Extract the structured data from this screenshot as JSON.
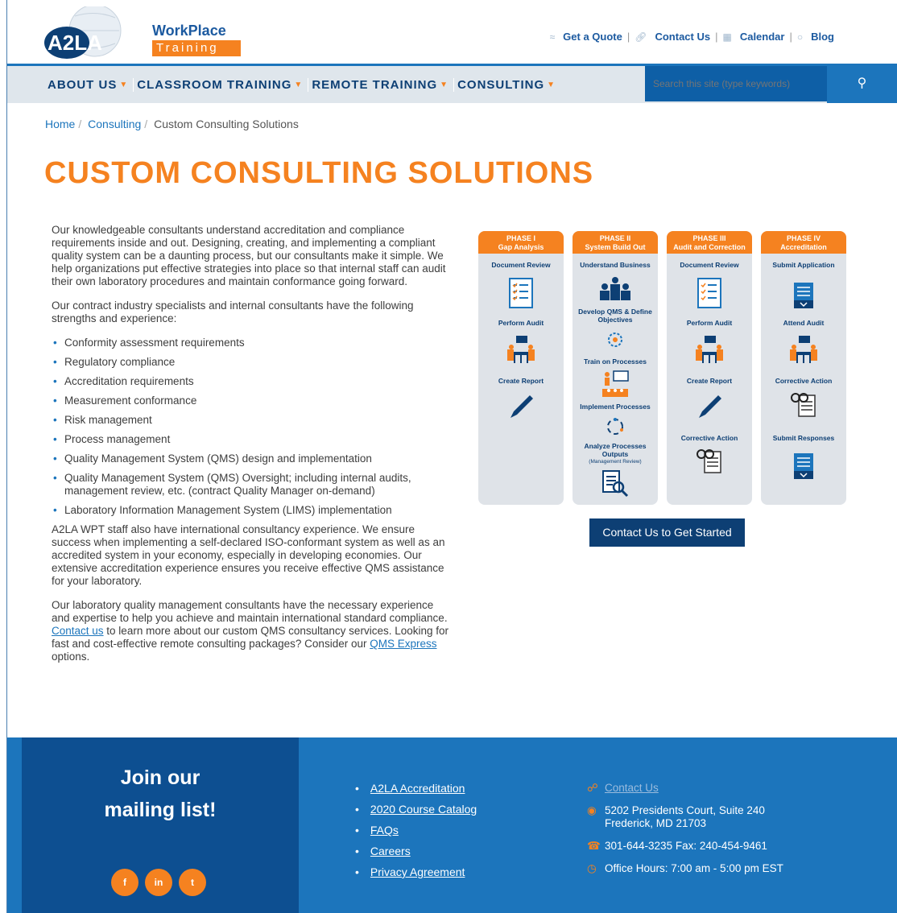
{
  "brand": {
    "wordmark": "WorkPlace",
    "tagline": "Training",
    "logo_text": "A2LA"
  },
  "toplinks": [
    {
      "label": "Get a Quote"
    },
    {
      "label": "Contact Us"
    },
    {
      "label": "Calendar"
    },
    {
      "label": "Blog"
    }
  ],
  "nav": {
    "items": [
      "ABOUT US",
      "CLASSROOM TRAINING",
      "REMOTE TRAINING",
      "CONSULTING"
    ],
    "search_placeholder": "Search this site (type keywords)"
  },
  "breadcrumb": {
    "home": "Home",
    "section": "Consulting",
    "current": "Custom Consulting Solutions"
  },
  "page_title": "CUSTOM CONSULTING SOLUTIONS",
  "content": {
    "p1": "Our knowledgeable consultants understand accreditation and compliance requirements inside and out. Designing, creating, and implementing a compliant quality system can be a daunting process, but our consultants make it simple. We help organizations put effective strategies into place so that internal staff can audit their own laboratory procedures and maintain conformance going forward.",
    "p2": "Our contract industry specialists and internal consultants have the following strengths and experience:",
    "list": [
      "Conformity assessment requirements",
      "Regulatory compliance",
      "Accreditation requirements",
      "Measurement conformance",
      "Risk management",
      "Process management",
      "Quality Management System (QMS) design and implementation",
      "Quality Management System (QMS) Oversight; including internal audits, management review, etc. (contract Quality Manager on-demand)",
      "Laboratory Information Management System (LIMS) implementation"
    ],
    "p3": "A2LA WPT staff also have international consultancy experience. We ensure success when implementing a self-declared ISO-conformant system as well as an accredited system in your economy, especially in developing economies. Our extensive accreditation experience ensures you receive effective QMS assistance for your laboratory.",
    "p4_a": "Our laboratory quality management consultants have the necessary experience and expertise to help you achieve and maintain international standard compliance. ",
    "p4_link1": "Contact us",
    "p4_b": " to learn more about our custom QMS consultancy services. Looking for fast and cost-effective remote consulting packages? Consider our ",
    "p4_link2": "QMS Express",
    "p4_c": " options."
  },
  "phases": [
    {
      "num": "PHASE I",
      "name": "Gap Analysis",
      "items": [
        "Document Review",
        "Perform Audit",
        "Create Report"
      ]
    },
    {
      "num": "PHASE II",
      "name": "System Build Out",
      "items": [
        "Understand Business",
        "Develop QMS & Define Objectives",
        "Train on Processes",
        "Implement Processes",
        "Analyze Processes Outputs"
      ],
      "note": "(Management Review)"
    },
    {
      "num": "PHASE III",
      "name": "Audit and Correction",
      "items": [
        "Document Review",
        "Perform Audit",
        "Create Report",
        "Corrective Action"
      ]
    },
    {
      "num": "PHASE IV",
      "name": "Accreditation",
      "items": [
        "Submit Application",
        "Attend Audit",
        "Corrective Action",
        "Submit Responses"
      ]
    }
  ],
  "cta": "Contact Us to Get Started",
  "footer": {
    "join_line1": "Join our",
    "join_line2": "mailing list!",
    "social": [
      "f",
      "in",
      "t"
    ],
    "links": [
      "A2LA Accreditation",
      "2020 Course Catalog",
      "FAQs",
      "Careers",
      "Privacy Agreement"
    ],
    "contact_link": "Contact Us",
    "address1": "5202 Presidents Court, Suite 240",
    "address2": "Frederick, MD 21703",
    "phone": "301-644-3235 Fax: 240-454-9461",
    "hours": "Office Hours: 7:00 am - 5:00 pm EST"
  },
  "colors": {
    "orange": "#f58220",
    "navy": "#0d3f74",
    "blue": "#1c75bc"
  }
}
